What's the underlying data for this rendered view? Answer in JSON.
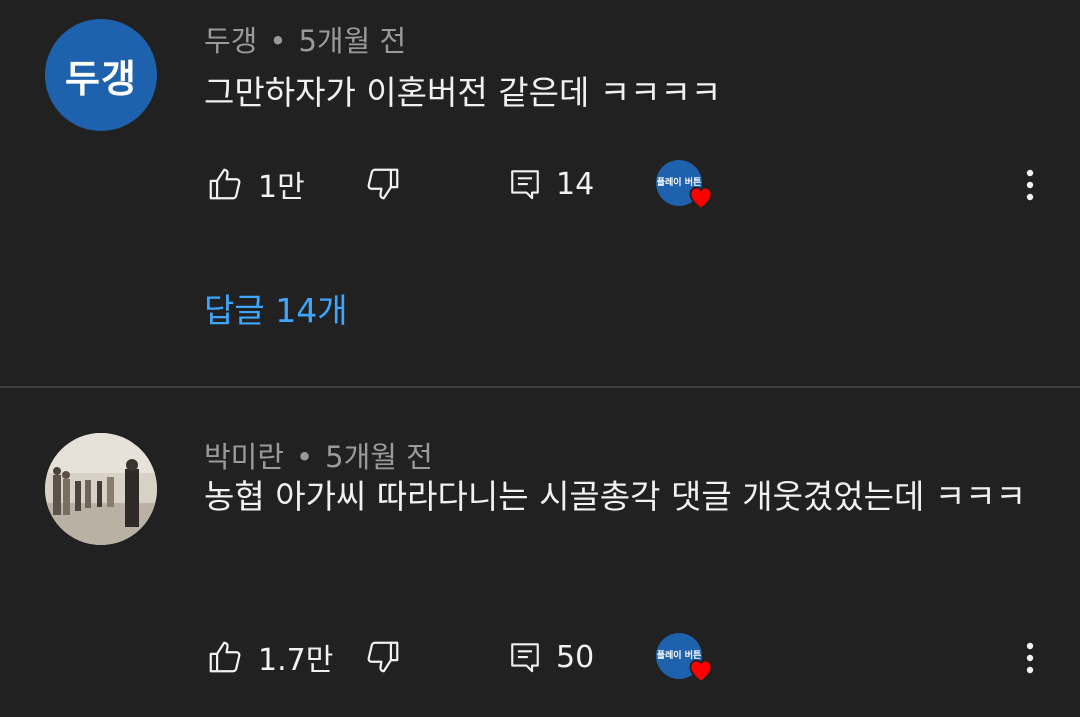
{
  "comments": [
    {
      "avatar_text": "두갱",
      "author": "두갱",
      "separator": "•",
      "time": "5개월 전",
      "text": "그만하자가 이혼버전 같은데 ㅋㅋㅋㅋ",
      "likes": "1만",
      "reply_count": "14",
      "hearted_by": "플레이 버튼",
      "replies_link": "답글 14개"
    },
    {
      "author": "박미란",
      "separator": "•",
      "time": "5개월 전",
      "text": "농협 아가씨 따라다니는 시골총각 댓글 개웃겼었는데 ㅋㅋㅋ",
      "likes": "1.7만",
      "reply_count": "50",
      "hearted_by": "플레이 버튼"
    }
  ],
  "icons": {
    "like": "thumbs-up-icon",
    "dislike": "thumbs-down-icon",
    "reply": "comment-icon",
    "heart": "heart-icon",
    "more": "more-vert-icon"
  },
  "colors": {
    "background": "#212121",
    "link": "#3ea6ff",
    "heart": "#ff0000",
    "avatar": "#1e62ad"
  }
}
